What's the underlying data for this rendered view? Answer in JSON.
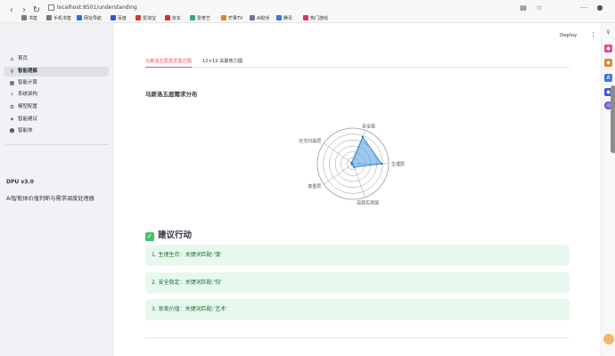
{
  "browser": {
    "url": "localhost:8501/understanding",
    "bookmarks": [
      "书签",
      "手机书签",
      "网址导航",
      "百度",
      "爱淘宝",
      "京东",
      "爱奇艺",
      "芒果TV",
      "AI助手",
      "腾讯",
      "热门游戏"
    ]
  },
  "header": {
    "deploy_label": "Deploy",
    "menu_icon": "⋮"
  },
  "sidebar": {
    "items": [
      {
        "label": "首页",
        "icon": "home-icon"
      },
      {
        "label": "智能理解",
        "icon": "search-icon"
      },
      {
        "label": "智能计算",
        "icon": "calc-icon"
      },
      {
        "label": "系统架构",
        "icon": "structure-icon"
      },
      {
        "label": "模型配置",
        "icon": "gear-icon"
      },
      {
        "label": "智能建议",
        "icon": "bulb-icon"
      },
      {
        "label": "智能体",
        "icon": "robot-icon"
      }
    ],
    "version": "DPU v3.0",
    "tagline": "AI智能体价值判断与需求调度处理器"
  },
  "tabs": [
    {
      "label": "马斯洛五层需求雷达图",
      "active": true
    },
    {
      "label": "12×12 关联热力图",
      "active": false
    }
  ],
  "chart_data": {
    "type": "radar",
    "title": "马斯洛五层需求分布",
    "axes": [
      "生理层",
      "安全层",
      "社交归属层",
      "尊重层",
      "自我实现层"
    ],
    "values": [
      0.8,
      0.8,
      0.05,
      0.0,
      0.1
    ],
    "rmax": 1.0,
    "colors": {
      "fill": "#4c9be8",
      "line": "#1f77b4",
      "grid": "#9b9b9b"
    }
  },
  "actions": {
    "title": "建议行动",
    "items": [
      "1.  生理生存：关键词匹配:'饿'",
      "2.  安全稳定：关键词匹配:'怕'",
      "3.  审美价值：关键词匹配:'艺术'"
    ]
  }
}
